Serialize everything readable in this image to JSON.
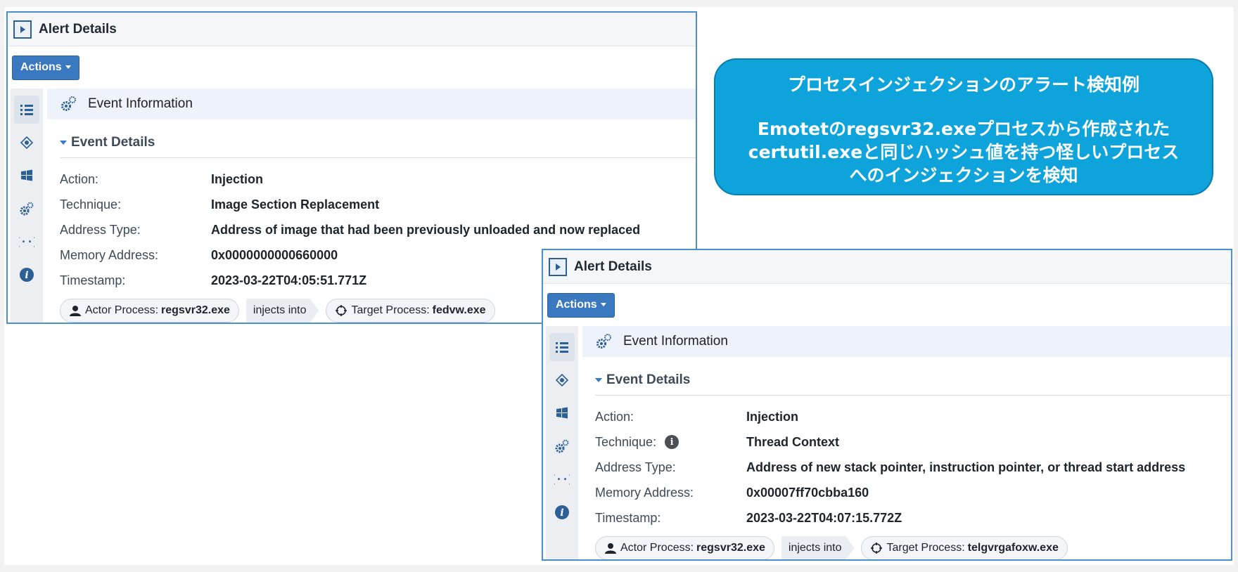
{
  "colors": {
    "accent": "#3a78bf",
    "panel_border": "#4a8fd0",
    "callout_bg": "#0ea4db"
  },
  "panels": [
    {
      "header_title": "Alert Details",
      "actions_label": "Actions",
      "section_title": "Event Information",
      "details_title": "Event Details",
      "fields": {
        "action_label": "Action:",
        "action_value": "Injection",
        "technique_label": "Technique:",
        "technique_value": "Image Section Replacement",
        "address_type_label": "Address Type:",
        "address_type_value": "Address of image that had been previously unloaded and now replaced",
        "memory_label": "Memory Address:",
        "memory_value": "0x0000000000660000",
        "timestamp_label": "Timestamp:",
        "timestamp_value": "2023-03-22T04:05:51.771Z"
      },
      "actor_label": "Actor Process:",
      "actor_value": "regsvr32.exe",
      "relation": "injects into",
      "target_label": "Target Process:",
      "target_value": "fedvw.exe"
    },
    {
      "header_title": "Alert Details",
      "actions_label": "Actions",
      "section_title": "Event Information",
      "details_title": "Event Details",
      "fields": {
        "action_label": "Action:",
        "action_value": "Injection",
        "technique_label": "Technique:",
        "technique_value": "Thread Context",
        "address_type_label": "Address Type:",
        "address_type_value": "Address of new stack pointer, instruction pointer, or thread start address",
        "memory_label": "Memory Address:",
        "memory_value": "0x00007ff70cbba160",
        "timestamp_label": "Timestamp:",
        "timestamp_value": "2023-03-22T04:07:15.772Z"
      },
      "actor_label": "Actor Process:",
      "actor_value": "regsvr32.exe",
      "relation": "injects into",
      "target_label": "Target Process:",
      "target_value": "telgvrgafoxw.exe"
    }
  ],
  "callout": {
    "title": "プロセスインジェクションのアラート検知例",
    "line1": "Emotetのregsvr32.exeプロセスから作成された",
    "line2": "certutil.exeと同じハッシュ値を持つ怪しいプロセス",
    "line3": "へのインジェクションを検知"
  }
}
